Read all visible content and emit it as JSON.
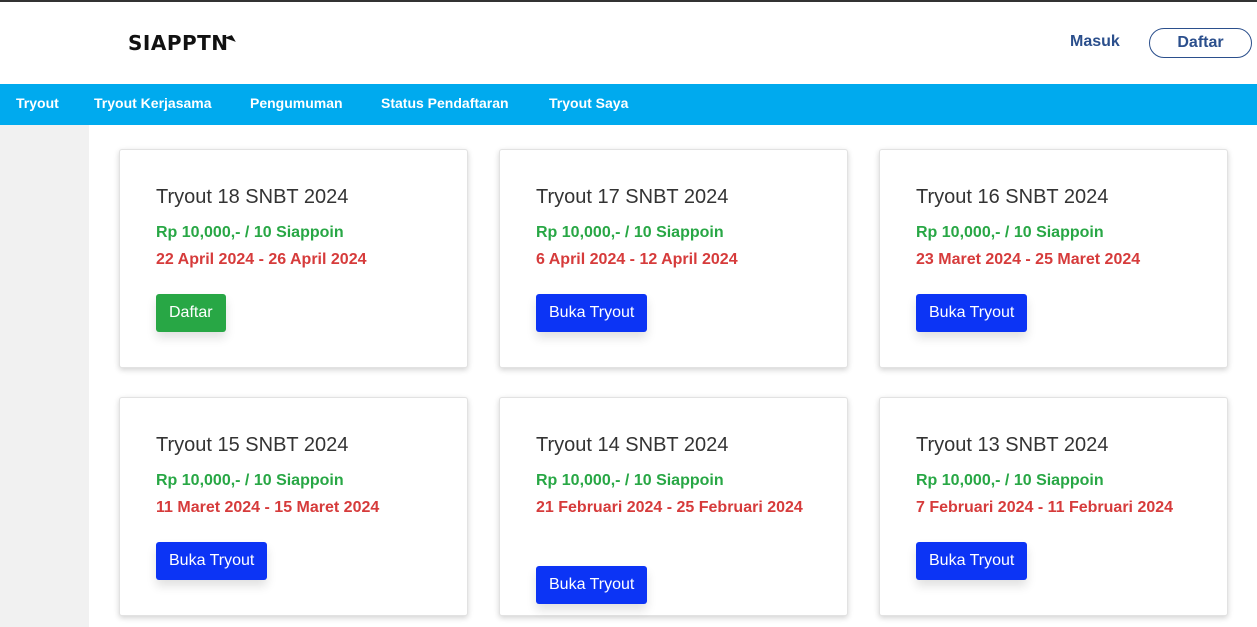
{
  "header": {
    "logo": "SIAPPTN",
    "login_label": "Masuk",
    "register_label": "Daftar"
  },
  "nav": {
    "items": [
      "Tryout",
      "Tryout Kerjasama",
      "Pengumuman",
      "Status Pendaftaran",
      "Tryout Saya"
    ]
  },
  "cards": [
    {
      "title": "Tryout 18 SNBT 2024",
      "price": "Rp 10,000,- / 10 Siappoin",
      "date": "22 April 2024 - 26 April 2024",
      "button": "Daftar"
    },
    {
      "title": "Tryout 17 SNBT 2024",
      "price": "Rp 10,000,- / 10 Siappoin",
      "date": "6 April 2024 - 12 April 2024",
      "button": "Buka Tryout"
    },
    {
      "title": "Tryout 16 SNBT 2024",
      "price": "Rp 10,000,- / 10 Siappoin",
      "date": "23 Maret 2024 - 25 Maret 2024",
      "button": "Buka Tryout"
    },
    {
      "title": "Tryout 15 SNBT 2024",
      "price": "Rp 10,000,- / 10 Siappoin",
      "date": "11 Maret 2024 - 15 Maret 2024",
      "button": "Buka Tryout"
    },
    {
      "title": "Tryout 14 SNBT 2024",
      "price": "Rp 10,000,- / 10 Siappoin",
      "date": "21 Februari 2024 - 25 Februari 2024",
      "button": "Buka Tryout"
    },
    {
      "title": "Tryout 13 SNBT 2024",
      "price": "Rp 10,000,- / 10 Siappoin",
      "date": "7 Februari 2024 - 11 Februari 2024",
      "button": "Buka Tryout"
    }
  ],
  "colors": {
    "nav_bg": "#00aaee",
    "price": "#28a745",
    "date": "#d63b3b",
    "register_button": "#28a745",
    "open_button": "#0c34f5",
    "brand_text": "#2b4f8c"
  }
}
